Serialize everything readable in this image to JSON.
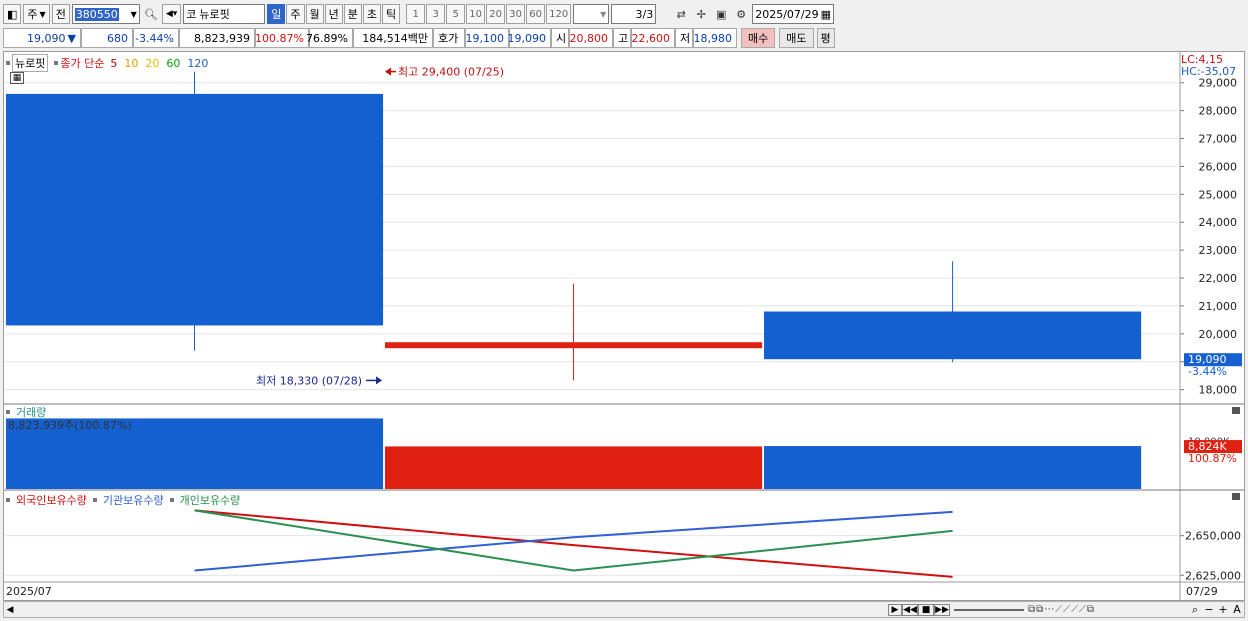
{
  "toolbar": {
    "market": "주",
    "prev": "전",
    "code": "380550",
    "market2": "코",
    "name": "뉴로핏",
    "periods": [
      "일",
      "주",
      "월",
      "년",
      "분",
      "초",
      "틱"
    ],
    "selected_period": "일",
    "intervals": [
      "1",
      "3",
      "5",
      "10",
      "20",
      "30",
      "60",
      "120"
    ],
    "page": "3/3",
    "date": "2025/07/29"
  },
  "quote": {
    "price": "19,090",
    "arrow": "▼",
    "change": "680",
    "change_pct": "-3.44%",
    "volume": "8,823,939",
    "vol_ratio": "100.87%",
    "turnover_pct": "76.89%",
    "amount": "184,514백만",
    "hoga_label": "호가",
    "ask": "19,100",
    "bid": "19,090",
    "open_label": "시",
    "open": "20,800",
    "high_label": "고",
    "high": "22,600",
    "low_label": "저",
    "low": "18,980",
    "buy": "매수",
    "sell": "매도",
    "eval": "평"
  },
  "price_pane": {
    "name": "뉴로핏",
    "ma_title": "종가 단순",
    "ma": [
      "5",
      "10",
      "20",
      "60",
      "120"
    ],
    "ma_colors": [
      "#c80000",
      "#e0a000",
      "#e0c000",
      "#00a000",
      "#2060c0"
    ],
    "high_note": "최고 29,400 (07/25)",
    "low_note": "최저 18,330 (07/28)",
    "lc": "LC:4,15",
    "hc": "HC:-35,07",
    "cur_price": "19,090",
    "cur_pct": "-3.44%"
  },
  "volume_pane": {
    "title": "거래량",
    "info": "8,823,939주(100.87%)",
    "cur_tag": "8,824K",
    "cur_pct": "100.87%"
  },
  "holdings_pane": {
    "series_names": [
      "외국인보유수량",
      "기관보유수량",
      "개인보유수량"
    ],
    "colors": [
      "#d01010",
      "#3060d0",
      "#2a9050"
    ]
  },
  "footer": {
    "left_date": "2025/07",
    "right_date": "07/29"
  },
  "chart_data": [
    {
      "type": "candlestick",
      "x": [
        "07/25",
        "07/28",
        "07/29"
      ],
      "open": [
        28600,
        19700,
        20800
      ],
      "close": [
        20300,
        19600,
        19090
      ],
      "high": [
        29400,
        21800,
        22600
      ],
      "low": [
        19400,
        18330,
        18980
      ],
      "colors": [
        "#1560d0",
        "#e02010",
        "#1560d0"
      ],
      "ylim": [
        17700,
        29600
      ],
      "yticks": [
        18000,
        19000,
        20000,
        21000,
        22000,
        23000,
        24000,
        25000,
        26000,
        27000,
        28000,
        29000
      ]
    },
    {
      "type": "bar",
      "name": "거래량",
      "x": [
        "07/25",
        "07/28",
        "07/29"
      ],
      "values": [
        14500000,
        8750000,
        8823939
      ],
      "colors": [
        "#1560d0",
        "#e02010",
        "#1560d0"
      ],
      "ylim": [
        0,
        15000000
      ],
      "ytick_label": "10,000K"
    },
    {
      "type": "line",
      "x": [
        "07/25",
        "07/28",
        "07/29"
      ],
      "series": [
        {
          "name": "외국인보유수량",
          "values": [
            2666000,
            2644000,
            2624000
          ]
        },
        {
          "name": "기관보유수량",
          "values": [
            2628000,
            2649000,
            2665000
          ]
        },
        {
          "name": "개인보유수량",
          "values": [
            2666000,
            2628000,
            2653000
          ]
        }
      ],
      "ylim": [
        2622000,
        2670000
      ],
      "yticks": [
        2625000,
        2650000
      ],
      "ytick_labels": [
        "2,625,000",
        "2,650,000"
      ]
    }
  ]
}
